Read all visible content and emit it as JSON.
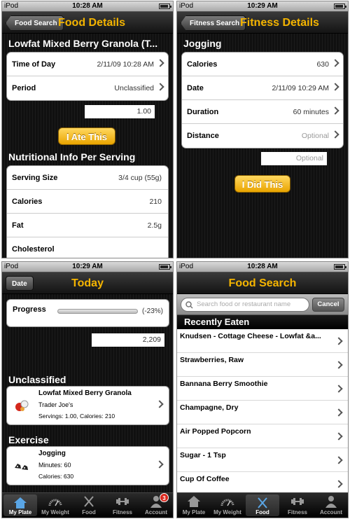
{
  "food_details": {
    "status": {
      "device": "iPod",
      "time": "10:28 AM"
    },
    "nav": {
      "back": "Food Search",
      "title": "Food Details"
    },
    "item_title": "Lowfat Mixed Berry Granola (T...",
    "rows": [
      {
        "label": "Time of Day",
        "value": "2/11/09 10:28 AM"
      },
      {
        "label": "Period",
        "value": "Unclassified"
      }
    ],
    "quantity": "1.00",
    "ate_button": "I Ate This",
    "nutrition_heading": "Nutritional Info Per Serving",
    "nutrition": [
      {
        "label": "Serving Size",
        "value": "3/4 cup (55g)"
      },
      {
        "label": "Calories",
        "value": "210"
      },
      {
        "label": "Fat",
        "value": "2.5g"
      },
      {
        "label": "Cholesterol",
        "value": ""
      }
    ]
  },
  "fitness_details": {
    "status": {
      "device": "iPod",
      "time": "10:29 AM"
    },
    "nav": {
      "back": "Fitness Search",
      "title": "Fitness Details"
    },
    "activity": "Jogging",
    "rows": [
      {
        "label": "Calories",
        "value": "630"
      },
      {
        "label": "Date",
        "value": "2/11/09 10:29 AM"
      },
      {
        "label": "Duration",
        "value": "60 minutes"
      },
      {
        "label": "Distance",
        "value": "Optional"
      }
    ],
    "optional_placeholder": "Optional",
    "did_button": "I Did This"
  },
  "today": {
    "status": {
      "device": "iPod",
      "time": "10:29 AM"
    },
    "nav": {
      "left": "Date",
      "title": "Today"
    },
    "progress": {
      "label": "Progress",
      "percent_text": "(-23%)"
    },
    "calories_total": "2,209",
    "sections": [
      {
        "heading": "Unclassified",
        "name": "Lowfat Mixed Berry Granola",
        "sub": "Trader Joe's",
        "detail": "Servings: 1.00, Calories: 210"
      },
      {
        "heading": "Exercise",
        "name": "Jogging",
        "sub": "Minutes: 60",
        "detail": "Calories: 630"
      }
    ],
    "tabs": [
      "My Plate",
      "My Weight",
      "Food",
      "Fitness",
      "Account"
    ],
    "badge": "3"
  },
  "food_search": {
    "status": {
      "device": "iPod",
      "time": "10:28 AM"
    },
    "nav": {
      "title": "Food Search"
    },
    "search_placeholder": "Search food or restaurant name",
    "cancel": "Cancel",
    "recent_heading": "Recently Eaten",
    "items": [
      "Knudsen - Cottage Cheese - Lowfat &a...",
      "Strawberries, Raw",
      "Bannana Berry Smoothie",
      "Champagne, Dry",
      "Air Popped Popcorn",
      "Sugar - 1 Tsp",
      "Cup Of Coffee"
    ],
    "tabs": [
      "My Plate",
      "My Weight",
      "Food",
      "Fitness",
      "Account"
    ]
  },
  "colors": {
    "accent": "#f4b400",
    "button": "#f2b81f",
    "badge": "#d9261c"
  }
}
